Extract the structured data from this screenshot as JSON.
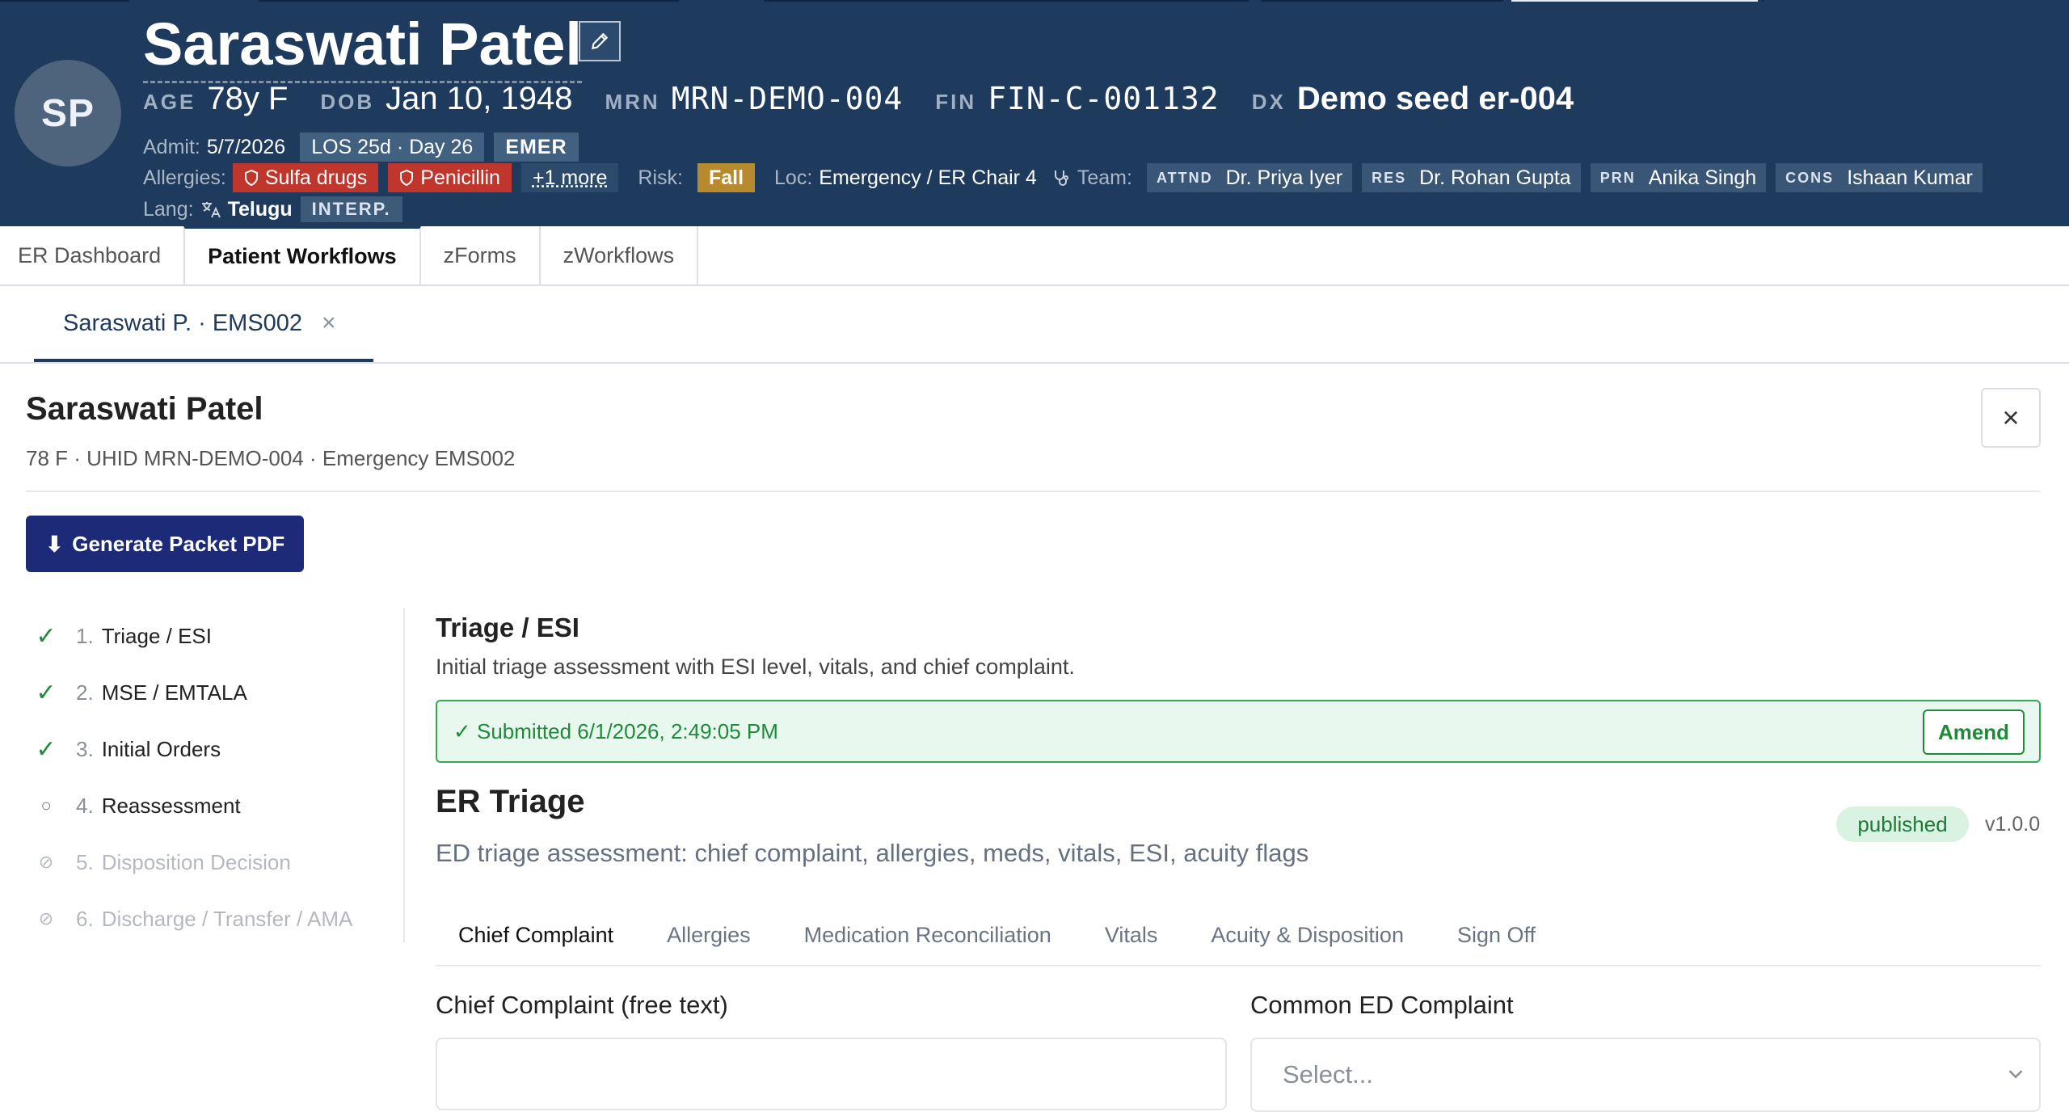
{
  "banner": {
    "initials": "SP",
    "name": "Saraswati Patel",
    "age_label": "AGE",
    "age": "78y F",
    "dob_label": "DOB",
    "dob": "Jan 10, 1948",
    "mrn_label": "MRN",
    "mrn": "MRN-DEMO-004",
    "fin_label": "FIN",
    "fin": "FIN-C-001132",
    "dx_label": "DX",
    "dx": "Demo seed er-004",
    "admit_label": "Admit:",
    "admit": "5/7/2026",
    "los": "LOS 25d · Day 26",
    "encounter_type": "EMER",
    "allergies_label": "Allergies:",
    "allergies": [
      "Sulfa drugs",
      "Penicillin"
    ],
    "allergies_more": "+1 more",
    "risk_label": "Risk:",
    "risk": "Fall",
    "loc_label": "Loc:",
    "loc": "Emergency / ER Chair 4",
    "team_label": "Team:",
    "team": [
      {
        "role": "ATTND",
        "name": "Dr. Priya Iyer"
      },
      {
        "role": "RES",
        "name": "Dr. Rohan Gupta"
      },
      {
        "role": "PRN",
        "name": "Anika Singh"
      },
      {
        "role": "CONS",
        "name": "Ishaan Kumar"
      }
    ],
    "lang_label": "Lang:",
    "lang": "Telugu",
    "interp": "INTERP."
  },
  "app_tabs": [
    "ER Dashboard",
    "Patient Workflows",
    "zForms",
    "zWorkflows"
  ],
  "patient_tab": {
    "label": "Saraswati P. · EMS002",
    "close": "×"
  },
  "workflow": {
    "title": "Saraswati Patel",
    "subtitle": "78 F · UHID MRN-DEMO-004 · Emergency EMS002",
    "close": "×",
    "generate_label": "Generate Packet PDF",
    "steps": [
      {
        "num": "1.",
        "label": "Triage / ESI",
        "status": "done"
      },
      {
        "num": "2.",
        "label": "MSE / EMTALA",
        "status": "done"
      },
      {
        "num": "3.",
        "label": "Initial Orders",
        "status": "done"
      },
      {
        "num": "4.",
        "label": "Reassessment",
        "status": "current"
      },
      {
        "num": "5.",
        "label": "Disposition Decision",
        "status": "locked"
      },
      {
        "num": "6.",
        "label": "Discharge / Transfer / AMA",
        "status": "locked"
      }
    ]
  },
  "step_content": {
    "title": "Triage / ESI",
    "description": "Initial triage assessment with ESI level, vitals, and chief complaint.",
    "submitted": "✓ Submitted 6/1/2026, 2:49:05 PM",
    "amend_label": "Amend"
  },
  "form": {
    "title": "ER Triage",
    "status": "published",
    "version": "v1.0.0",
    "description": "ED triage assessment: chief complaint, allergies, meds, vitals, ESI, acuity flags",
    "tabs": [
      "Chief Complaint",
      "Allergies",
      "Medication Reconciliation",
      "Vitals",
      "Acuity & Disposition",
      "Sign Off"
    ],
    "chief_complaint_label": "Chief Complaint (free text)",
    "chief_complaint_value": "",
    "common_complaint_label": "Common ED Complaint",
    "common_complaint_placeholder": "Select..."
  },
  "colors": {
    "banner_bg": "#1e3a5c",
    "allergy_chip": "#c0362c",
    "risk_chip": "#b88a2e",
    "primary_button": "#1c2a78",
    "success": "#1f8a3a"
  },
  "icons": {
    "edit": "pencil-icon",
    "allergy": "shield-icon",
    "team": "stethoscope-icon",
    "lang": "translate-icon",
    "download": "download-arrow-icon",
    "step_done": "check-icon",
    "step_current": "circle-icon",
    "step_locked": "blocked-icon",
    "select": "chevron-down-icon"
  }
}
